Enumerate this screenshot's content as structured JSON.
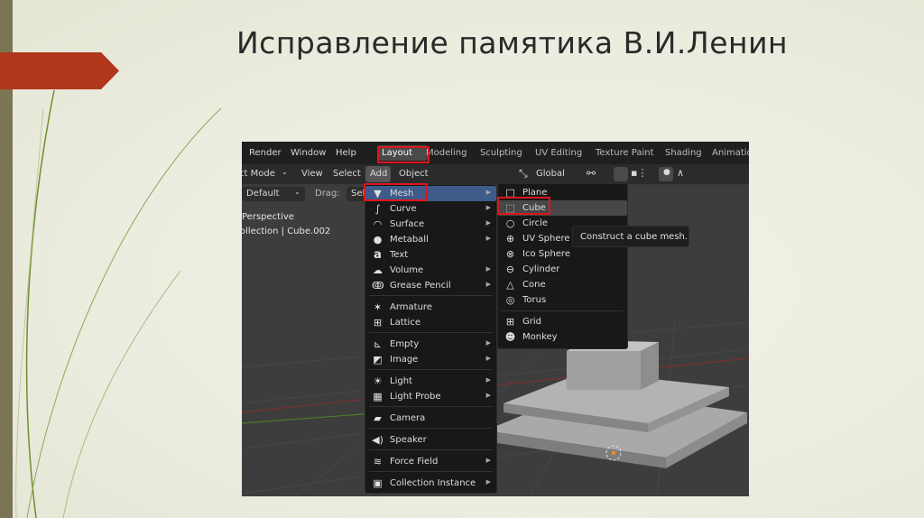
{
  "slide": {
    "title": "Исправление памятика В.И.Ленин"
  },
  "menubar": {
    "items": [
      "Render",
      "Window",
      "Help"
    ],
    "workspaces": [
      "Layout",
      "Modeling",
      "Sculpting",
      "UV Editing",
      "Texture Paint",
      "Shading",
      "Animatio"
    ],
    "active_workspace": "Layout"
  },
  "toolbar": {
    "mode_label": "ct Mode",
    "view_label": "View",
    "select_label": "Select",
    "add_label": "Add",
    "object_label": "Object",
    "transform_label": "Global"
  },
  "header2": {
    "orientation_label": "Default",
    "drag_label": "Drag:",
    "drag_value": "Sel"
  },
  "viewport": {
    "view_name": "Perspective",
    "collection_text": "ollection | Cube.002"
  },
  "add_menu": {
    "items": [
      {
        "label": "Mesh",
        "icon": "mesh-icon",
        "submenu": true
      },
      {
        "label": "Curve",
        "icon": "curve-icon",
        "submenu": true
      },
      {
        "label": "Surface",
        "icon": "surface-icon",
        "submenu": true
      },
      {
        "label": "Metaball",
        "icon": "metaball-icon",
        "submenu": true
      },
      {
        "label": "Text",
        "icon": "text-icon",
        "submenu": false
      },
      {
        "label": "Volume",
        "icon": "volume-icon",
        "submenu": true
      },
      {
        "label": "Grease Pencil",
        "icon": "grease-pencil-icon",
        "submenu": true
      },
      {
        "label": "Armature",
        "icon": "armature-icon",
        "submenu": false
      },
      {
        "label": "Lattice",
        "icon": "lattice-icon",
        "submenu": false
      },
      {
        "label": "Empty",
        "icon": "empty-icon",
        "submenu": true
      },
      {
        "label": "Image",
        "icon": "image-icon",
        "submenu": true
      },
      {
        "label": "Light",
        "icon": "light-icon",
        "submenu": true
      },
      {
        "label": "Light Probe",
        "icon": "light-probe-icon",
        "submenu": true
      },
      {
        "label": "Camera",
        "icon": "camera-icon",
        "submenu": false
      },
      {
        "label": "Speaker",
        "icon": "speaker-icon",
        "submenu": false
      },
      {
        "label": "Force Field",
        "icon": "force-field-icon",
        "submenu": true
      },
      {
        "label": "Collection Instance",
        "icon": "collection-instance-icon",
        "submenu": true
      }
    ]
  },
  "mesh_menu": {
    "items": [
      {
        "label": "Plane",
        "icon": "plane-icon"
      },
      {
        "label": "Cube",
        "icon": "cube-icon"
      },
      {
        "label": "Circle",
        "icon": "circle-icon"
      },
      {
        "label": "UV Sphere",
        "icon": "uv-sphere-icon"
      },
      {
        "label": "Ico Sphere",
        "icon": "ico-sphere-icon"
      },
      {
        "label": "Cylinder",
        "icon": "cylinder-icon"
      },
      {
        "label": "Cone",
        "icon": "cone-icon"
      },
      {
        "label": "Torus",
        "icon": "torus-icon"
      },
      {
        "label": "Grid",
        "icon": "grid-icon"
      },
      {
        "label": "Monkey",
        "icon": "monkey-icon"
      }
    ]
  },
  "tooltip": {
    "text": "Construct a cube mesh."
  },
  "colors": {
    "highlight_box": "#e0141a",
    "menu_highlight": "#3f5b8a",
    "accent_bar": "#7b7553",
    "title_arrow": "#b0361c"
  }
}
